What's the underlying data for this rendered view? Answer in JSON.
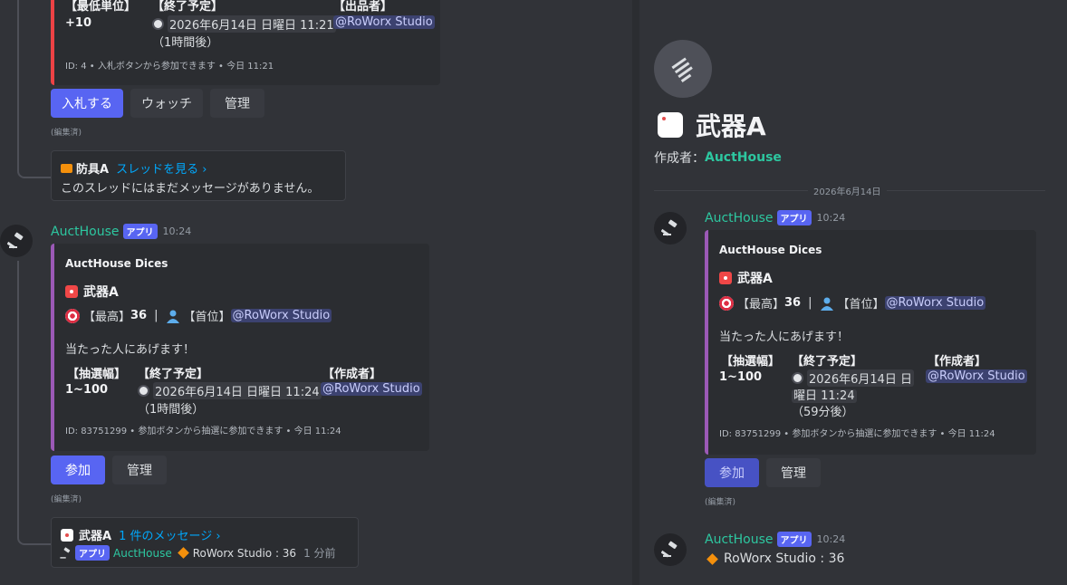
{
  "left": {
    "top_embed": {
      "fields": [
        {
          "name": "【最低単位】",
          "value": "+10"
        },
        {
          "name": "【終了予定】",
          "value": "2026年6月14日 日曜日 11:21",
          "sub": "（1時間後）"
        },
        {
          "name": "【出品者】",
          "value": "@RoWorx Studio"
        }
      ],
      "footer": "ID: 4 • 入札ボタンから参加できます • 今日 11:21"
    },
    "buttons1": {
      "bid": "入札する",
      "watch": "ウォッチ",
      "manage": "管理"
    },
    "edited1": "(編集済)",
    "thread1": {
      "title": "防具A",
      "link": "スレッドを見る ›",
      "body": "このスレッドにはまだメッセージがありません。"
    },
    "msg": {
      "author": "AuctHouse",
      "badge": "アプリ",
      "time": "10:24",
      "embed": {
        "provider": "AuctHouse Dices",
        "title": "武器A",
        "stats": {
          "max_label": "【最高】",
          "max_value": "36",
          "sep": "|",
          "top_label": "【首位】",
          "top_value": "@RoWorx Studio"
        },
        "desc": "当たった人にあげます！",
        "fields": [
          {
            "name": "【抽選幅】",
            "value": "1~100"
          },
          {
            "name": "【終了予定】",
            "value": "2026年6月14日 日曜日 11:24",
            "sub": "（1時間後）"
          },
          {
            "name": "【作成者】",
            "value": "@RoWorx Studio"
          }
        ],
        "footer": "ID: 83751299 • 参加ボタンから抽選に参加できます • 今日 11:24"
      },
      "buttons": {
        "join": "参加",
        "manage": "管理"
      },
      "edited": "(編集済)"
    },
    "thread2": {
      "title": "武器A",
      "link": "1 件のメッセージ ›",
      "badge": "アプリ",
      "author": "AuctHouse",
      "preview": "RoWorx Studio : 36",
      "ago": "1 分前"
    }
  },
  "right": {
    "thread_title": "武器A",
    "creator_label": "作成者：",
    "creator_name": "AuctHouse",
    "date_divider": "2026年6月14日",
    "msg1": {
      "author": "AuctHouse",
      "badge": "アプリ",
      "time": "10:24",
      "embed": {
        "provider": "AuctHouse Dices",
        "title": "武器A",
        "stats": {
          "max_label": "【最高】",
          "max_value": "36",
          "sep": "|",
          "top_label": "【首位】",
          "top_value": "@RoWorx Studio"
        },
        "desc": "当たった人にあげます！",
        "fields": [
          {
            "name": "【抽選幅】",
            "value": "1~100"
          },
          {
            "name": "【終了予定】",
            "value": "2026年6月14日 日",
            "value2": "曜日 11:24",
            "sub": "（59分後）"
          },
          {
            "name": "【作成者】",
            "value": "@RoWorx Studio"
          }
        ],
        "footer": "ID: 83751299 • 参加ボタンから抽選に参加できます • 今日 11:24"
      },
      "buttons": {
        "join": "参加",
        "manage": "管理"
      },
      "edited": "(編集済)"
    },
    "msg2": {
      "author": "AuctHouse",
      "badge": "アプリ",
      "time": "10:24",
      "text": "RoWorx Studio : 36"
    }
  }
}
